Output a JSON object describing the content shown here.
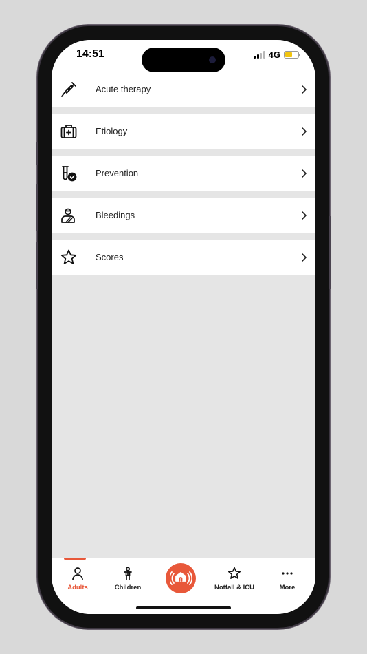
{
  "status_bar": {
    "time": "14:51",
    "network": "4G"
  },
  "menu": {
    "items": [
      {
        "label": "Acute therapy",
        "icon": "syringe-icon"
      },
      {
        "label": "Etiology",
        "icon": "first-aid-kit-icon"
      },
      {
        "label": "Prevention",
        "icon": "test-tube-check-icon"
      },
      {
        "label": "Bleedings",
        "icon": "injured-person-icon"
      },
      {
        "label": "Scores",
        "icon": "star-icon"
      }
    ]
  },
  "tab_bar": {
    "tabs": [
      {
        "label": "Adults",
        "icon": "person-icon",
        "active": true
      },
      {
        "label": "Children",
        "icon": "child-icon",
        "active": false
      },
      {
        "label": "",
        "icon": "home-emergency-icon",
        "active": false
      },
      {
        "label": "Notfall & ICU",
        "icon": "star-outline-icon",
        "active": false
      },
      {
        "label": "More",
        "icon": "ellipsis-icon",
        "active": false
      }
    ]
  },
  "colors": {
    "accent": "#e8583a",
    "background": "#e5e5e5",
    "battery": "#f1c40f"
  }
}
